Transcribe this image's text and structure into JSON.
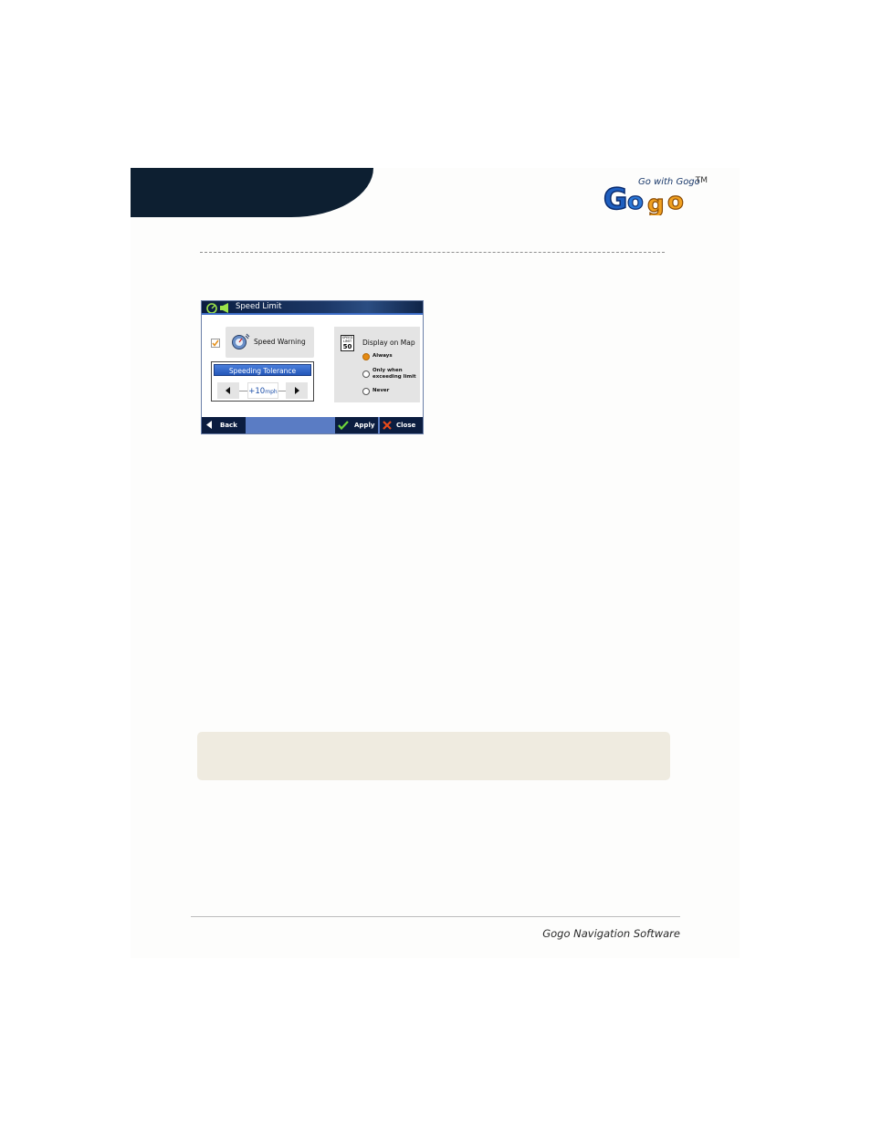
{
  "header": {
    "logo_tagline": "Go with Gogo",
    "logo_tm": "TM",
    "logo_word": "Gogo"
  },
  "screenshot": {
    "title": "Speed Limit",
    "speed_warning_label": "Speed Warning",
    "speed_warning_checked": true,
    "tolerance_header": "Speeding Tolerance",
    "tolerance_value": "+10",
    "tolerance_unit": "mph",
    "sign_top": "SPEED LIMIT",
    "sign_number": "50",
    "display_on_map_label": "Display on Map",
    "options": [
      {
        "label": "Always",
        "selected": true
      },
      {
        "label_line1": "Only when",
        "label_line2": "exceeding limit",
        "selected": false
      },
      {
        "label": "Never",
        "selected": false
      }
    ],
    "back_label": "Back",
    "apply_label": "Apply",
    "close_label": "Close"
  },
  "footer": {
    "text": "Gogo Navigation Software"
  },
  "colors": {
    "header_band": "#0d1f31",
    "note_box": "#efebe0",
    "accent_blue": "#2356b8",
    "radio_selected": "#e58a12"
  }
}
